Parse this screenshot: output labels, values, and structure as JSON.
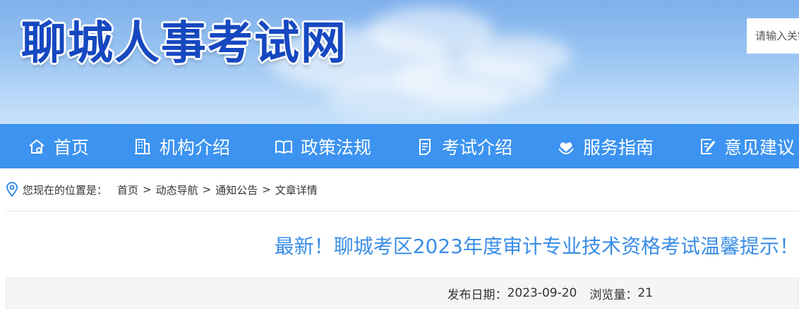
{
  "site": {
    "title": "聊城人事考试网",
    "search_placeholder": "请输入关键字"
  },
  "nav": {
    "items": [
      {
        "label": "首页",
        "icon": "home-icon"
      },
      {
        "label": "机构介绍",
        "icon": "building-icon"
      },
      {
        "label": "政策法规",
        "icon": "book-icon"
      },
      {
        "label": "考试介绍",
        "icon": "document-icon"
      },
      {
        "label": "服务指南",
        "icon": "heart-hand-icon"
      },
      {
        "label": "意见建议",
        "icon": "edit-icon"
      }
    ]
  },
  "breadcrumb": {
    "prefix": "您现在的位置是：",
    "items": [
      "首页",
      "动态导航",
      "通知公告",
      "文章详情"
    ],
    "separator": ">"
  },
  "article": {
    "title": "最新！聊城考区2023年度审计专业技术资格考试温馨提示！",
    "date_label": "发布日期：",
    "date": "2023-09-20",
    "views_label": "浏览量：",
    "views": "21"
  },
  "colors": {
    "nav_bg": "#3c93f0",
    "title_blue": "#3a8de6",
    "logo_blue": "#1648c0"
  }
}
